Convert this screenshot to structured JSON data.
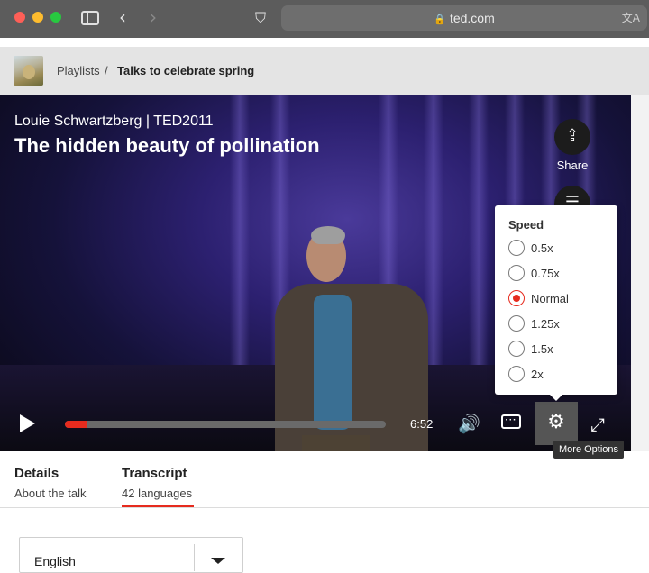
{
  "browser": {
    "url": "ted.com",
    "icons": [
      "sidebar-icon",
      "back-icon",
      "forward-icon",
      "shield-icon",
      "lock-icon",
      "translate-icon"
    ]
  },
  "breadcrumb": {
    "parent": "Playlists",
    "separator": "/",
    "current": "Talks to celebrate spring"
  },
  "video": {
    "speaker": "Louie Schwartzberg | TED2011",
    "title": "The hidden beauty of pollination",
    "share_label": "Share",
    "time": "6:52",
    "progress": 0.07
  },
  "speed_menu": {
    "heading": "Speed",
    "options": [
      {
        "label": "0.5x",
        "selected": false
      },
      {
        "label": "0.75x",
        "selected": false
      },
      {
        "label": "Normal",
        "selected": true
      },
      {
        "label": "1.25x",
        "selected": false
      },
      {
        "label": "1.5x",
        "selected": false
      },
      {
        "label": "2x",
        "selected": false
      }
    ]
  },
  "tooltip": "More Options",
  "tabs": [
    {
      "title": "Details",
      "subtitle": "About the talk",
      "active": false
    },
    {
      "title": "Transcript",
      "subtitle": "42 languages",
      "active": true
    }
  ],
  "language_select": {
    "value": "English"
  },
  "colors": {
    "accent": "#e62b1e"
  }
}
